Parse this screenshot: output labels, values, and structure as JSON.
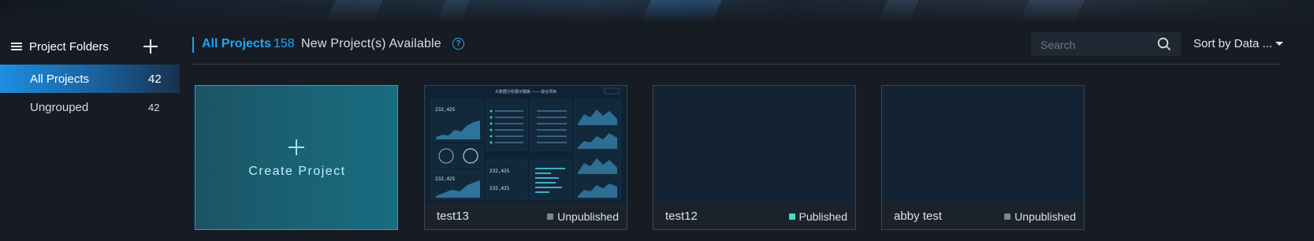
{
  "sidebar": {
    "title": "Project Folders",
    "items": [
      {
        "label": "All Projects",
        "count": "42"
      },
      {
        "label": "Ungrouped",
        "count": "42"
      }
    ]
  },
  "header": {
    "title": "All Projects",
    "count": "158",
    "available_text": "New Project(s) Available",
    "help_glyph": "?"
  },
  "search": {
    "placeholder": "Search"
  },
  "sort": {
    "label": "Sort by Data ..."
  },
  "create_card": {
    "label": "Create Project"
  },
  "projects": [
    {
      "name": "test13",
      "status": "Unpublished",
      "status_color": "#7d8590",
      "thumbnail_title": "大数据分析展示模板 —— 综合项目",
      "thumbnail_values": [
        "232,425",
        "232,425",
        "232,425",
        "232,425"
      ]
    },
    {
      "name": "test12",
      "status": "Published",
      "status_color": "#3fe0c5"
    },
    {
      "name": "abby test",
      "status": "Unpublished",
      "status_color": "#7d8590"
    }
  ],
  "colors": {
    "accent": "#1fa6f2",
    "background": "#171c24"
  }
}
